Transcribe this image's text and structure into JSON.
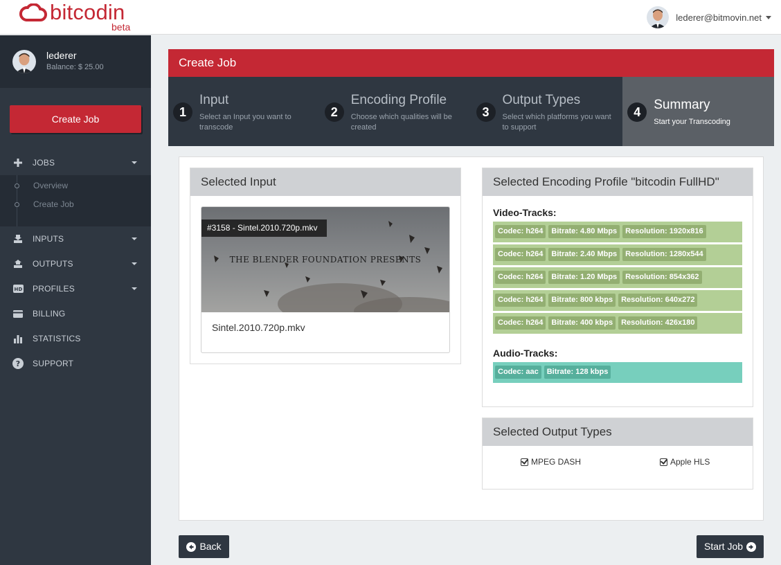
{
  "brand": {
    "name": "bitcodin",
    "tag": "beta",
    "color": "#c42834"
  },
  "topbar": {
    "email": "lederer@bitmovin.net"
  },
  "sidebar": {
    "user_name": "lederer",
    "balance": "Balance: $ 25.00",
    "create_button": "Create Job",
    "nav": {
      "jobs": "JOBS",
      "inputs": "INPUTS",
      "outputs": "OUTPUTS",
      "profiles": "PROFILES",
      "billing": "BILLING",
      "statistics": "STATISTICS",
      "support": "SUPPORT"
    },
    "jobs_sub": {
      "overview": "Overview",
      "create_job": "Create Job"
    }
  },
  "page": {
    "title": "Create Job"
  },
  "steps": [
    {
      "num": "1",
      "title": "Input",
      "desc": "Select an Input you want to transcode"
    },
    {
      "num": "2",
      "title": "Encoding Profile",
      "desc": "Choose which qualities will be created"
    },
    {
      "num": "3",
      "title": "Output Types",
      "desc": "Select which platforms you want to support"
    },
    {
      "num": "4",
      "title": "Summary",
      "desc": "Start your Transcoding",
      "active": true
    }
  ],
  "selected_input": {
    "heading": "Selected Input",
    "thumb_label": "#3158 - Sintel.2010.720p.mkv",
    "thumb_text": "THE BLENDER FOUNDATION PRESENTS",
    "file_name": "Sintel.2010.720p.mkv"
  },
  "profile": {
    "heading": "Selected Encoding Profile \"bitcodin FullHD\"",
    "video_heading": "Video-Tracks:",
    "audio_heading": "Audio-Tracks:",
    "video_tracks": [
      {
        "codec": "Codec: h264",
        "bitrate": "Bitrate: 4.80 Mbps",
        "resolution": "Resolution: 1920x816"
      },
      {
        "codec": "Codec: h264",
        "bitrate": "Bitrate: 2.40 Mbps",
        "resolution": "Resolution: 1280x544"
      },
      {
        "codec": "Codec: h264",
        "bitrate": "Bitrate: 1.20 Mbps",
        "resolution": "Resolution: 854x362"
      },
      {
        "codec": "Codec: h264",
        "bitrate": "Bitrate: 800 kbps",
        "resolution": "Resolution: 640x272"
      },
      {
        "codec": "Codec: h264",
        "bitrate": "Bitrate: 400 kbps",
        "resolution": "Resolution: 426x180"
      }
    ],
    "audio_tracks": [
      {
        "codec": "Codec: aac",
        "bitrate": "Bitrate: 128 kbps"
      }
    ]
  },
  "outputs": {
    "heading": "Selected Output Types",
    "items": [
      "MPEG DASH",
      "Apple HLS"
    ]
  },
  "buttons": {
    "back": "Back",
    "start": "Start Job"
  }
}
